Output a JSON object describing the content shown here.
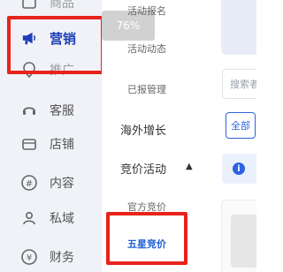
{
  "sidebar": {
    "items": [
      {
        "label": "商品",
        "icon": "store-icon"
      },
      {
        "label": "营销",
        "icon": "megaphone-icon"
      },
      {
        "label": "推广",
        "icon": "location-icon"
      },
      {
        "label": "客服",
        "icon": "headset-icon"
      },
      {
        "label": "店铺",
        "icon": "shop-icon"
      },
      {
        "label": "内容",
        "icon": "hashtag-icon"
      },
      {
        "label": "私域",
        "icon": "users-icon"
      },
      {
        "label": "财务",
        "icon": "yen-icon"
      }
    ]
  },
  "submenu": {
    "items": [
      "活动报名",
      "活动动态",
      "已报管理"
    ],
    "group_overseas": "海外增长",
    "group_bidding": "竞价活动",
    "bidding_items": [
      "官方竞价",
      "五星竞价"
    ]
  },
  "badge": {
    "text": "76%"
  },
  "right_panel": {
    "search_placeholder": "搜索者",
    "tab_all": "全部",
    "info_icon_glyph": "i"
  },
  "colors": {
    "highlight": "#e8231b",
    "active_blue": "#1f3fb8",
    "link_blue": "#2f62e0"
  }
}
